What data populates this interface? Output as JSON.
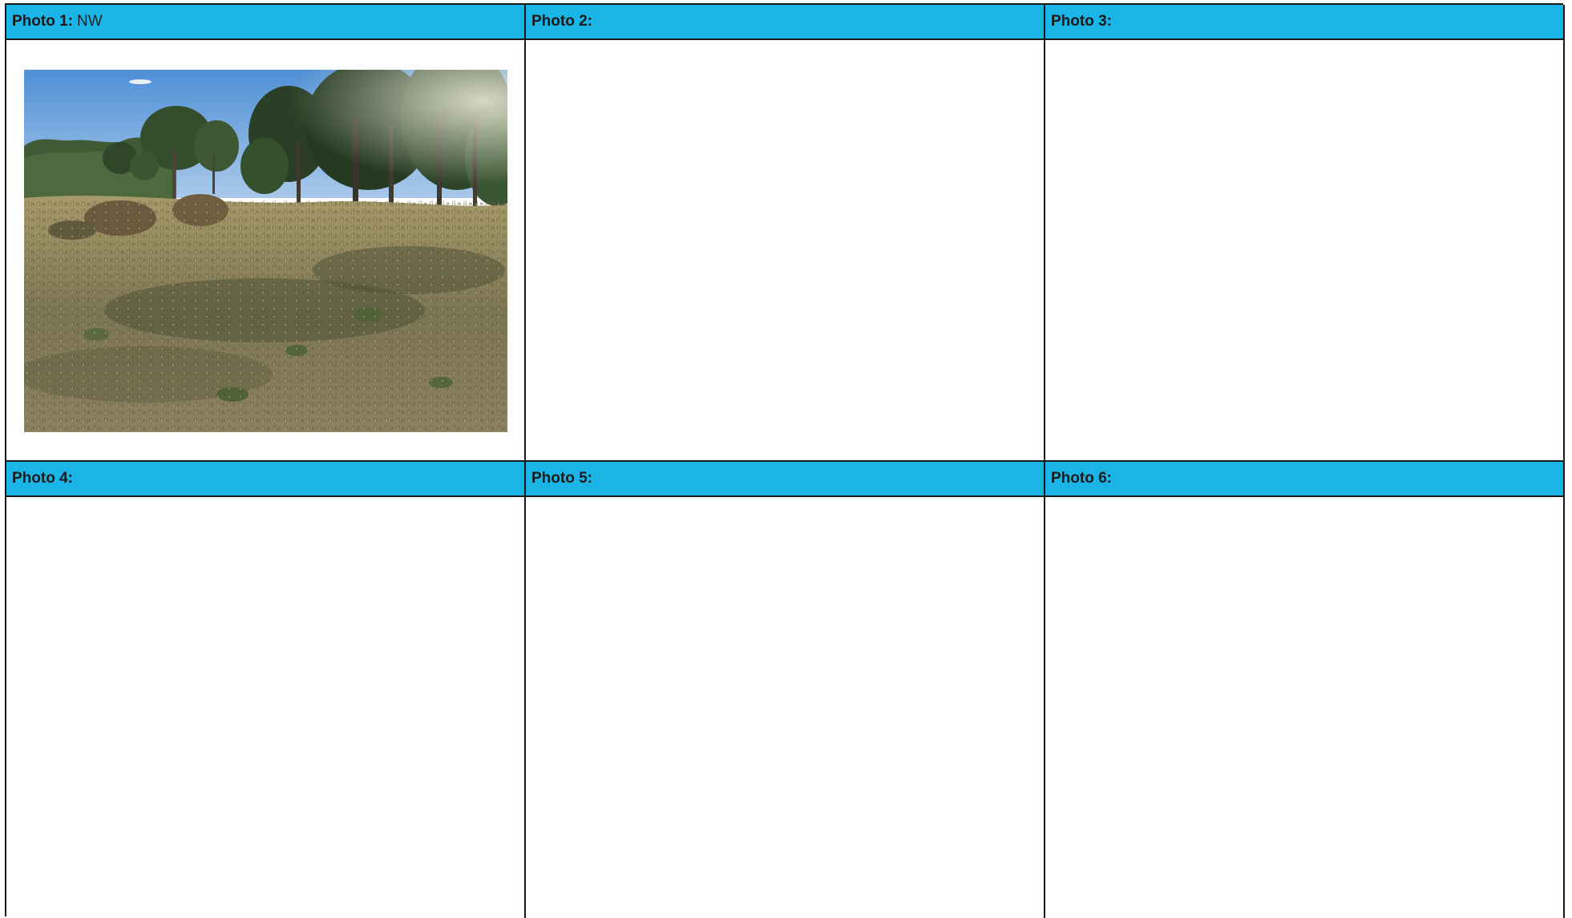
{
  "photos": [
    {
      "label": "Photo 1:",
      "direction": "NW",
      "has_image": true,
      "image_icon": "landscape-photo"
    },
    {
      "label": "Photo 2:",
      "direction": "",
      "has_image": false
    },
    {
      "label": "Photo 3:",
      "direction": "",
      "has_image": false
    },
    {
      "label": "Photo 4:",
      "direction": "",
      "has_image": false
    },
    {
      "label": "Photo 5:",
      "direction": "",
      "has_image": false
    },
    {
      "label": "Photo 6:",
      "direction": "",
      "has_image": false
    }
  ],
  "colors": {
    "header_bg": "#1ab4e6",
    "border": "#1a1a1a",
    "background": "#ffffff"
  }
}
